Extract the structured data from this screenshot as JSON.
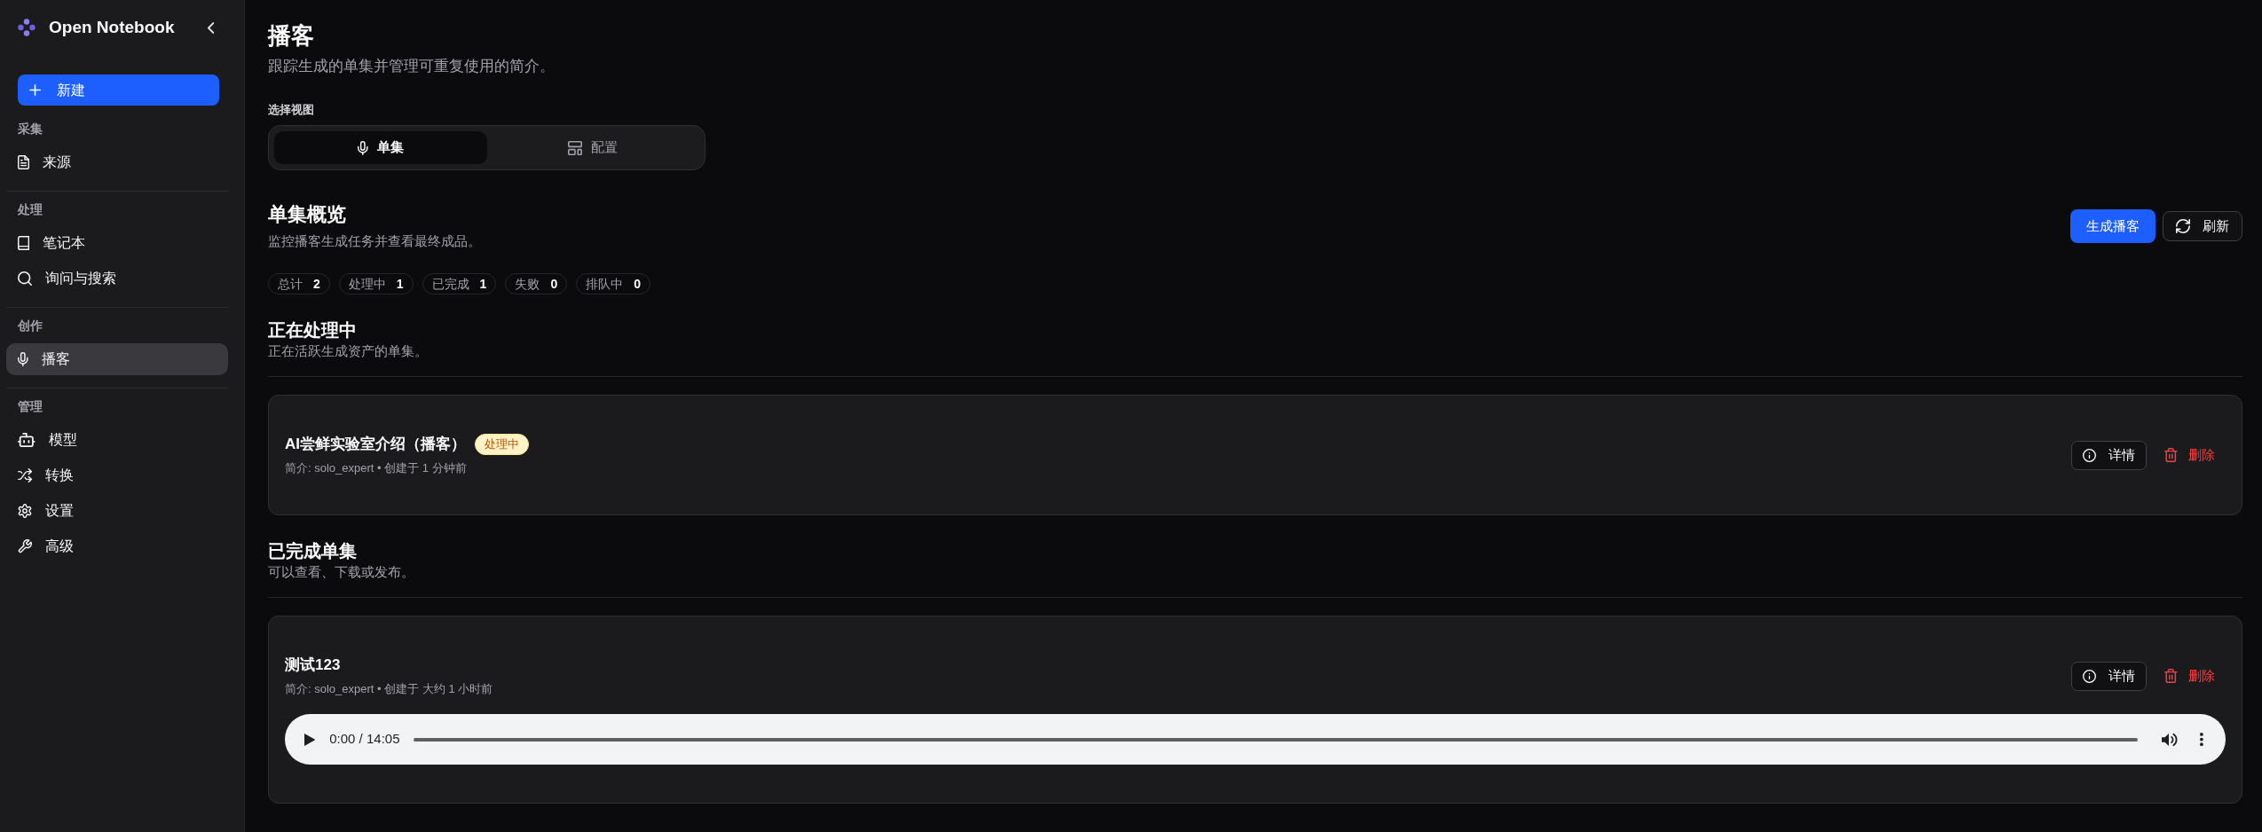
{
  "sidebar": {
    "brand": "Open Notebook",
    "new_button": "新建",
    "sections": [
      {
        "label": "采集",
        "items": [
          {
            "label": "来源",
            "selected": false
          }
        ]
      },
      {
        "label": "处理",
        "items": [
          {
            "label": "笔记本",
            "selected": false
          },
          {
            "label": "询问与搜索",
            "selected": false
          }
        ]
      },
      {
        "label": "创作",
        "items": [
          {
            "label": "播客",
            "selected": true
          }
        ]
      },
      {
        "label": "管理",
        "items": [
          {
            "label": "模型",
            "selected": false
          },
          {
            "label": "转换",
            "selected": false
          },
          {
            "label": "设置",
            "selected": false
          },
          {
            "label": "高级",
            "selected": false
          }
        ]
      }
    ]
  },
  "header": {
    "title": "播客",
    "subtitle": "跟踪生成的单集并管理可重复使用的简介。"
  },
  "view_switch": {
    "label": "选择视图",
    "tabs": [
      {
        "label": "单集",
        "selected": true
      },
      {
        "label": "配置",
        "selected": false
      }
    ]
  },
  "overview": {
    "title": "单集概览",
    "subtitle": "监控播客生成任务并查看最终成品。",
    "buttons": [
      {
        "kind": "primary",
        "label": "生成播客"
      },
      {
        "kind": "refresh",
        "label": "刷新"
      }
    ],
    "stats": [
      {
        "label": "总计",
        "count": "2"
      },
      {
        "label": "处理中",
        "count": "1"
      },
      {
        "label": "已完成",
        "count": "1"
      },
      {
        "label": "失败",
        "count": "0"
      },
      {
        "label": "排队中",
        "count": "0"
      }
    ]
  },
  "groups": [
    {
      "title": "正在处理中",
      "subtitle": "正在活跃生成资产的单集。",
      "episodes": [
        {
          "title": "AI尝鲜实验室介绍（播客）",
          "badge": "处理中",
          "meta": "简介: solo_expert • 创建于 1 分钟前",
          "actions": [
            {
              "kind": "details",
              "label": "详情"
            },
            {
              "kind": "delete",
              "label": "删除"
            }
          ]
        }
      ]
    },
    {
      "title": "已完成单集",
      "subtitle": "可以查看、下载或发布。",
      "episodes": [
        {
          "title": "测试123",
          "meta": "简介: solo_expert • 创建于 大约 1 小时前",
          "actions": [
            {
              "kind": "details",
              "label": "详情"
            },
            {
              "kind": "delete",
              "label": "删除"
            }
          ],
          "audio": {
            "time": "0:00 / 14:05"
          }
        }
      ]
    }
  ]
}
